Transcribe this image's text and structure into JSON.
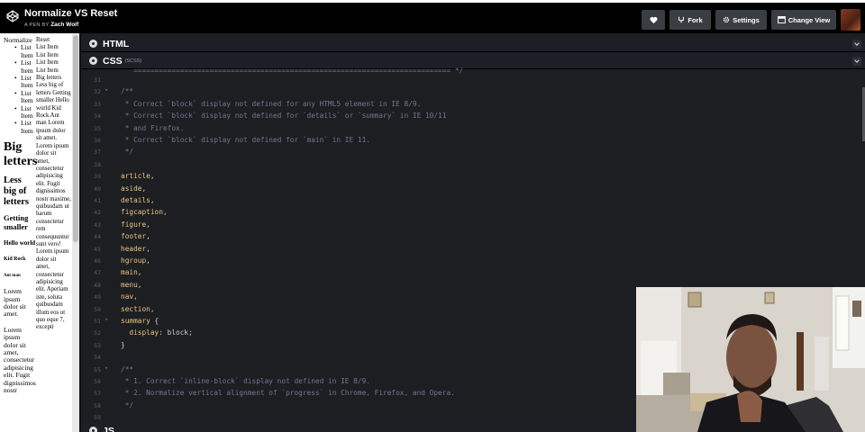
{
  "app": {
    "pen_title": "Normalize VS Reset",
    "byline_prefix": "A PEN BY",
    "author": "Zach Wolf"
  },
  "toolbar": {
    "like_icon": "heart-icon",
    "fork_label": "Fork",
    "settings_label": "Settings",
    "change_view_label": "Change View"
  },
  "preview": {
    "col1_list_title": "Normalize",
    "col1_items": [
      "List Item",
      "List Item",
      "List Item",
      "List Item",
      "List Item",
      "List Item"
    ],
    "big": "Big letters",
    "less": "Less big of letters",
    "getting": "Getting smaller",
    "hello": "Hello world",
    "kid": "Kid Rock",
    "ant": "Ant man",
    "lorem1": "Lorem ipsum dolor sit amet.",
    "lorem2": "Lorem ipsum dolor sit amet, consectetur adipisicing elit. Fugit dignissimos nostr",
    "col2_title": "Reset",
    "col2_items": [
      "List Item",
      "List Item",
      "List Item",
      "List Item"
    ],
    "col2_text": "Big letters Less big of letters Getting smaller Hello world Kid Rock Ant man Lorem ipsum dolor sit amet. Lorem ipsum dolor sit amet, consectetur adipisicing elit. Fugit dignissimos nostr maxime, quibusdam ut harum consectetur rem consequuntur sunt vero! Lorem ipsum dolor sit amet, consectetur adipisicing elit. Aperiam iste, soluta quibusdam illum eos ut quo eque 7, excepti"
  },
  "panes": {
    "html_label": "HTML",
    "css_label": "CSS",
    "css_sub": "(SCSS)",
    "js_label": "JS"
  },
  "code": {
    "top_partial": "   =========================================================================== */",
    "lines": [
      {
        "n": "31",
        "fold": "",
        "segs": [
          {
            "t": "",
            "c": "c-punc"
          }
        ]
      },
      {
        "n": "32",
        "fold": "▾",
        "segs": [
          {
            "t": "/**",
            "c": "c-comment"
          }
        ]
      },
      {
        "n": "33",
        "fold": "",
        "segs": [
          {
            "t": " * Correct `block` display not defined for any HTML5 element in IE 8/9.",
            "c": "c-comment"
          }
        ]
      },
      {
        "n": "34",
        "fold": "",
        "segs": [
          {
            "t": " * Correct `block` display not defined for `details` or `summary` in IE 10/11",
            "c": "c-comment"
          }
        ]
      },
      {
        "n": "35",
        "fold": "",
        "segs": [
          {
            "t": " * and Firefox.",
            "c": "c-comment"
          }
        ]
      },
      {
        "n": "36",
        "fold": "",
        "segs": [
          {
            "t": " * Correct `block` display not defined for `main` in IE 11.",
            "c": "c-comment"
          }
        ]
      },
      {
        "n": "37",
        "fold": "",
        "segs": [
          {
            "t": " */",
            "c": "c-comment"
          }
        ]
      },
      {
        "n": "38",
        "fold": "",
        "segs": [
          {
            "t": "",
            "c": "c-punc"
          }
        ]
      },
      {
        "n": "39",
        "fold": "",
        "segs": [
          {
            "t": "article",
            "c": "c-sel"
          },
          {
            "t": ",",
            "c": "c-punc"
          }
        ]
      },
      {
        "n": "40",
        "fold": "",
        "segs": [
          {
            "t": "aside",
            "c": "c-sel"
          },
          {
            "t": ",",
            "c": "c-punc"
          }
        ]
      },
      {
        "n": "41",
        "fold": "",
        "segs": [
          {
            "t": "details",
            "c": "c-sel"
          },
          {
            "t": ",",
            "c": "c-punc"
          }
        ]
      },
      {
        "n": "42",
        "fold": "",
        "segs": [
          {
            "t": "figcaption",
            "c": "c-sel"
          },
          {
            "t": ",",
            "c": "c-punc"
          }
        ]
      },
      {
        "n": "43",
        "fold": "",
        "segs": [
          {
            "t": "figure",
            "c": "c-sel"
          },
          {
            "t": ",",
            "c": "c-punc"
          }
        ]
      },
      {
        "n": "44",
        "fold": "",
        "segs": [
          {
            "t": "footer",
            "c": "c-sel"
          },
          {
            "t": ",",
            "c": "c-punc"
          }
        ]
      },
      {
        "n": "45",
        "fold": "",
        "segs": [
          {
            "t": "header",
            "c": "c-sel"
          },
          {
            "t": ",",
            "c": "c-punc"
          }
        ]
      },
      {
        "n": "46",
        "fold": "",
        "segs": [
          {
            "t": "hgroup",
            "c": "c-sel"
          },
          {
            "t": ",",
            "c": "c-punc"
          }
        ]
      },
      {
        "n": "47",
        "fold": "",
        "segs": [
          {
            "t": "main",
            "c": "c-sel"
          },
          {
            "t": ",",
            "c": "c-punc"
          }
        ]
      },
      {
        "n": "48",
        "fold": "",
        "segs": [
          {
            "t": "menu",
            "c": "c-sel"
          },
          {
            "t": ",",
            "c": "c-punc"
          }
        ]
      },
      {
        "n": "49",
        "fold": "",
        "segs": [
          {
            "t": "nav",
            "c": "c-sel"
          },
          {
            "t": ",",
            "c": "c-punc"
          }
        ]
      },
      {
        "n": "50",
        "fold": "",
        "segs": [
          {
            "t": "section",
            "c": "c-sel"
          },
          {
            "t": ",",
            "c": "c-punc"
          }
        ]
      },
      {
        "n": "51",
        "fold": "▾",
        "segs": [
          {
            "t": "summary",
            "c": "c-sel"
          },
          {
            "t": " {",
            "c": "c-punc"
          }
        ]
      },
      {
        "n": "52",
        "fold": "",
        "segs": [
          {
            "t": "  display",
            "c": "c-sel"
          },
          {
            "t": ": block;",
            "c": "c-prop"
          }
        ]
      },
      {
        "n": "53",
        "fold": "",
        "segs": [
          {
            "t": "}",
            "c": "c-punc"
          }
        ]
      },
      {
        "n": "54",
        "fold": "",
        "segs": [
          {
            "t": "",
            "c": "c-punc"
          }
        ]
      },
      {
        "n": "55",
        "fold": "▾",
        "segs": [
          {
            "t": "/**",
            "c": "c-comment"
          }
        ]
      },
      {
        "n": "56",
        "fold": "",
        "segs": [
          {
            "t": " * 1. Correct `inline-block` display not defined in IE 8/9.",
            "c": "c-comment"
          }
        ]
      },
      {
        "n": "57",
        "fold": "",
        "segs": [
          {
            "t": " * 2. Normalize vertical alignment of `progress` in Chrome, Firefox, and Opera.",
            "c": "c-comment"
          }
        ]
      },
      {
        "n": "58",
        "fold": "",
        "segs": [
          {
            "t": " */",
            "c": "c-comment"
          }
        ]
      },
      {
        "n": "59",
        "fold": "",
        "segs": [
          {
            "t": "",
            "c": "c-punc"
          }
        ]
      }
    ]
  },
  "colors": {
    "background": "#131417",
    "editor": "#1d1e22",
    "selector": "#e8c77e",
    "comment": "#717790"
  }
}
